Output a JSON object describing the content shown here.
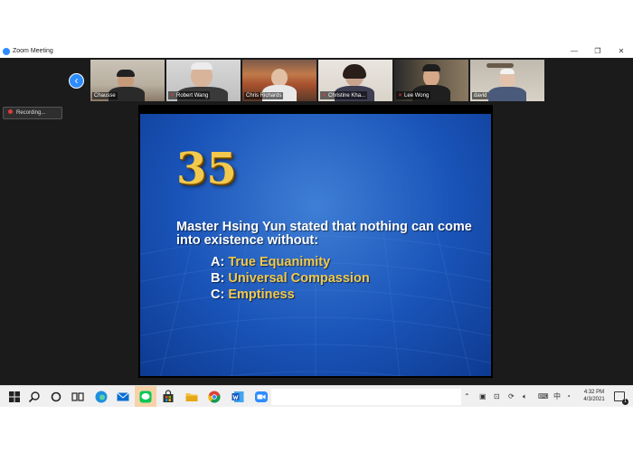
{
  "window": {
    "title": "Zoom Meeting",
    "controls": [
      "—",
      "❐",
      "✕"
    ]
  },
  "gallery": {
    "back_icon": "‹",
    "participants": [
      {
        "name": "Chausse",
        "muted": false
      },
      {
        "name": "Robert Wang",
        "muted": true
      },
      {
        "name": "Chris Richards",
        "muted": false
      },
      {
        "name": "Christine Kha...",
        "muted": true
      },
      {
        "name": "Lee Wong",
        "muted": true
      },
      {
        "name": "david",
        "muted": false
      }
    ]
  },
  "recording": {
    "label": "Recording..."
  },
  "slide": {
    "number": "35",
    "question": "Master Hsing Yun stated that nothing can come into existence without:",
    "options": [
      {
        "letter": "A:",
        "text": "True Equanimity"
      },
      {
        "letter": "B:",
        "text": "Universal Compassion"
      },
      {
        "letter": "C:",
        "text": "Emptiness"
      }
    ],
    "colors": {
      "answer": "#f2c94c",
      "background": "#1a54b8"
    }
  },
  "taskbar": {
    "icons": [
      "windows-start-icon",
      "search-icon",
      "cortana-icon",
      "task-view-icon",
      "edge-icon",
      "mail-icon",
      "line-app-icon",
      "store-icon",
      "file-explorer-icon",
      "chrome-icon",
      "word-icon",
      "zoom-icon"
    ],
    "tray_ime": "中",
    "time": "4:32 PM",
    "date": "4/3/2021",
    "notification_count": "1"
  }
}
